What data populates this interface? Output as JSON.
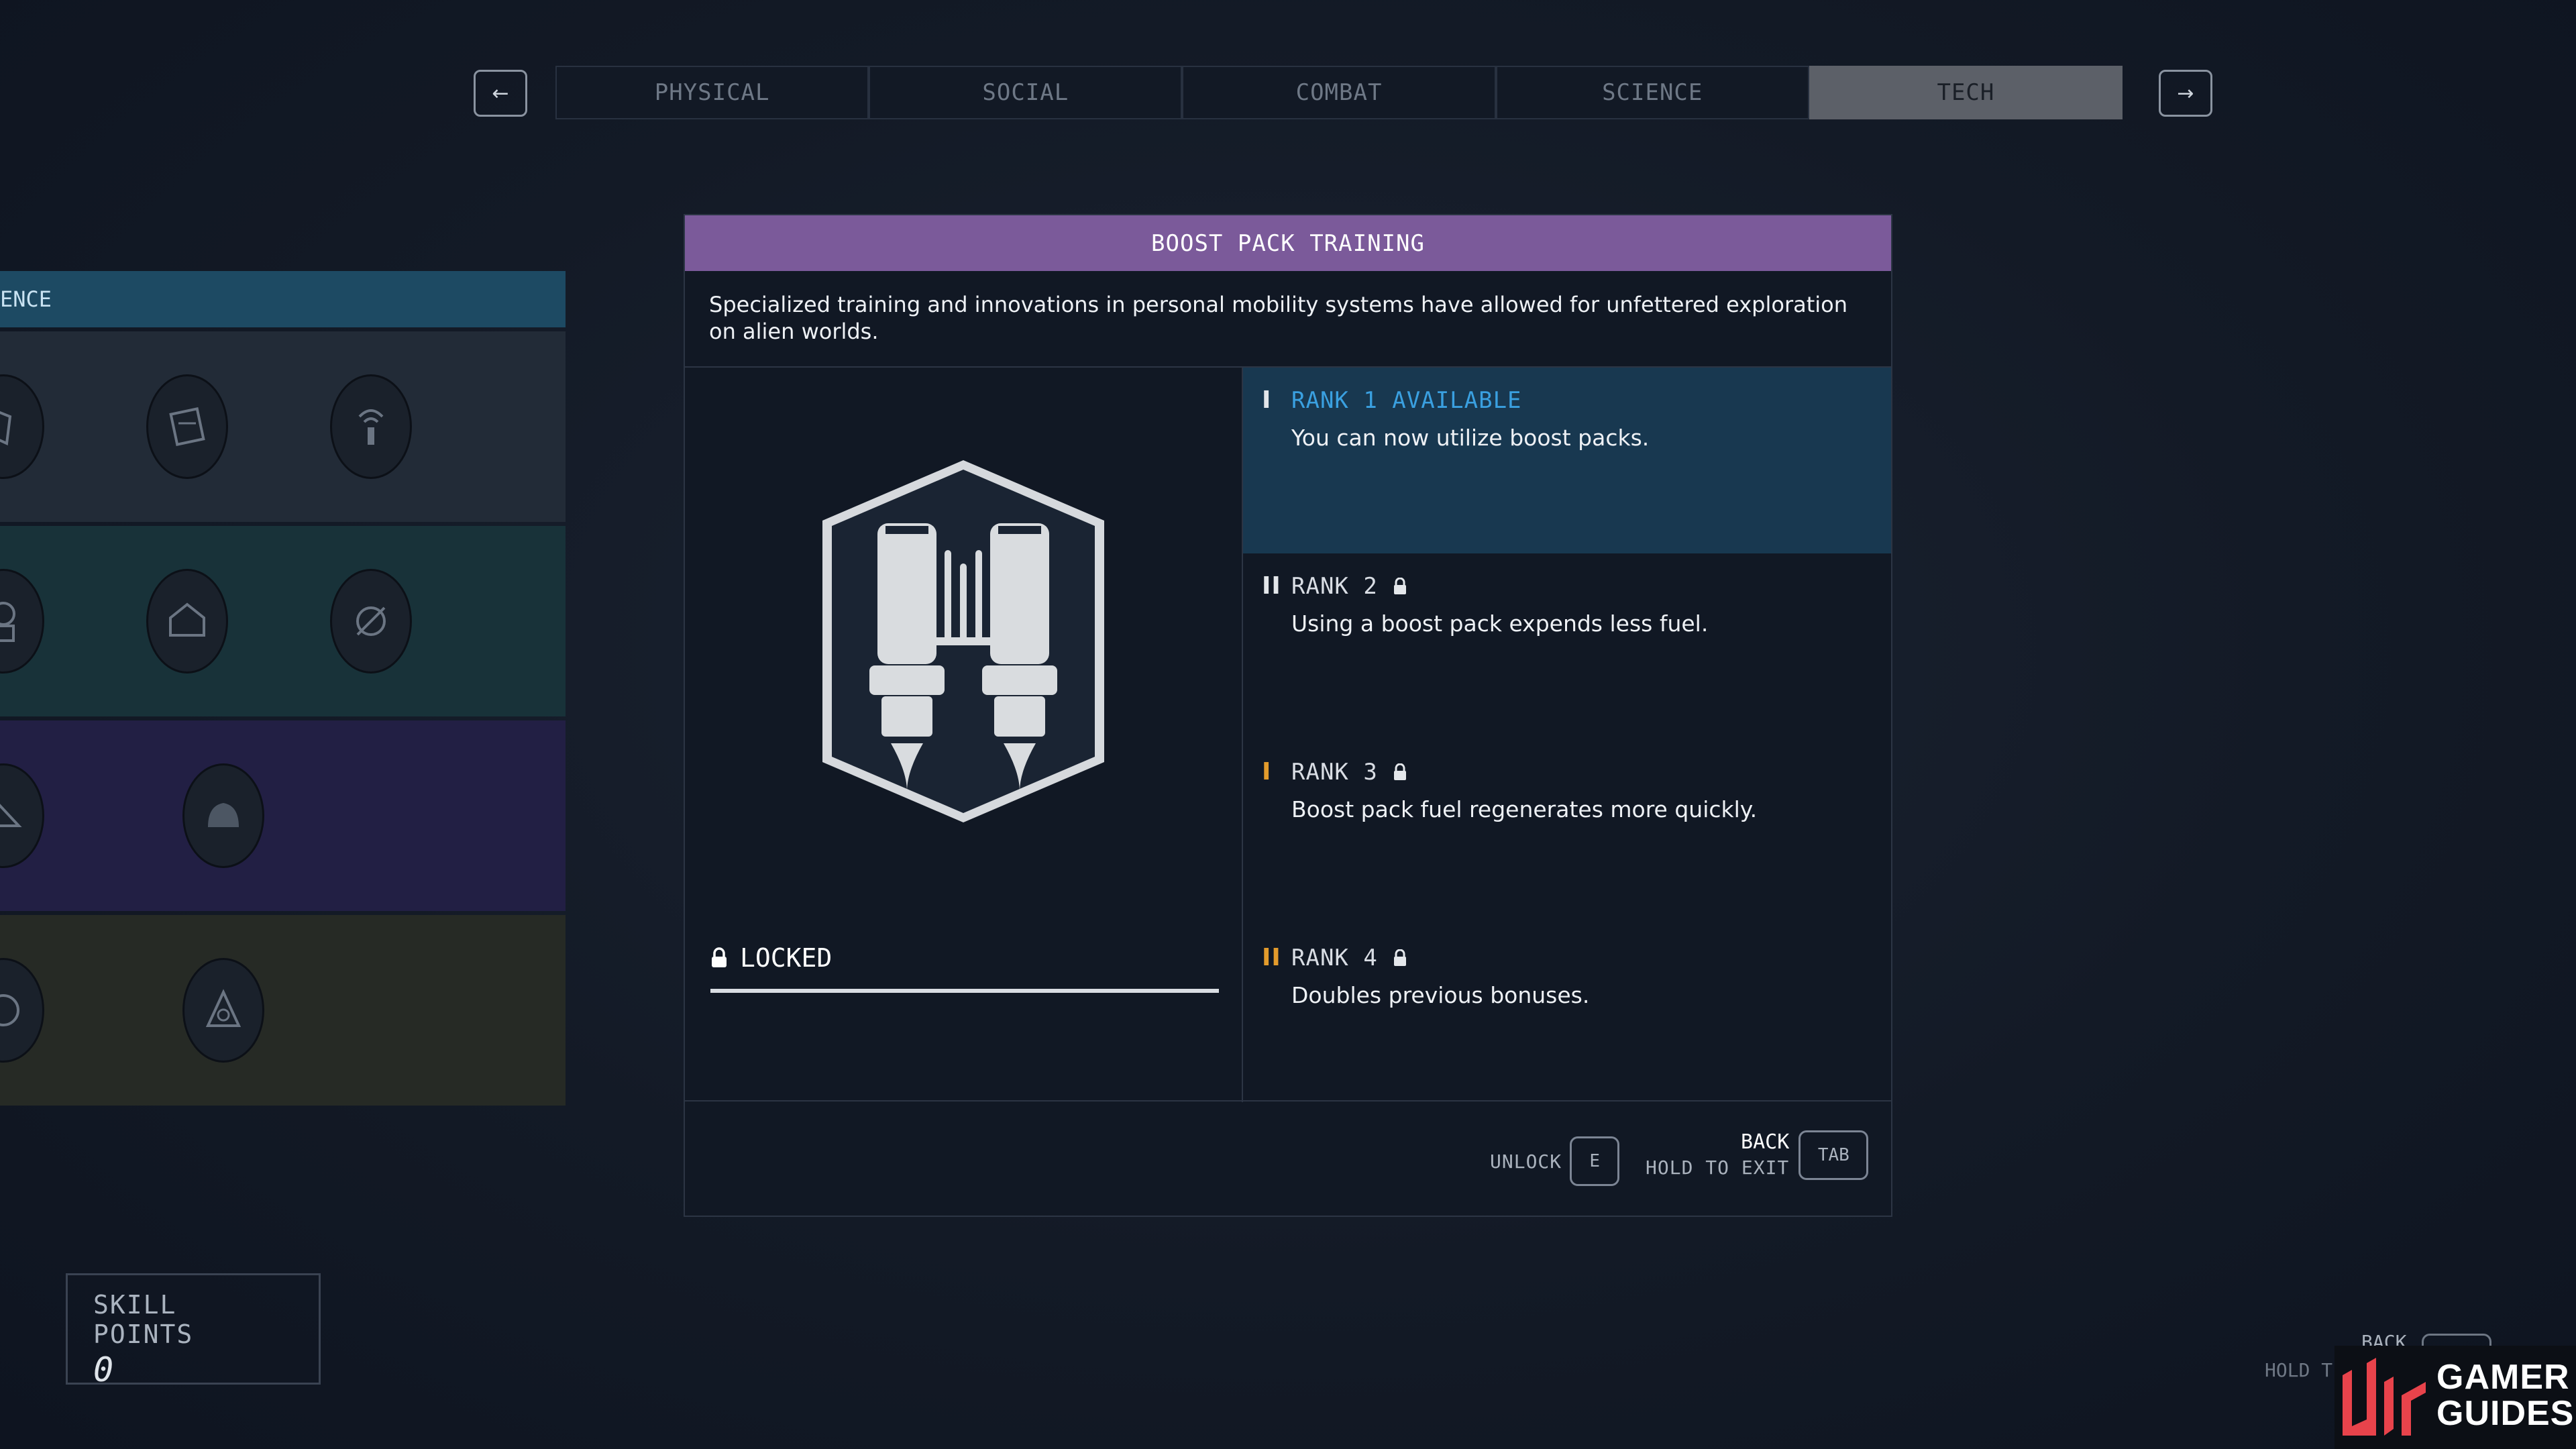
{
  "tabs": [
    {
      "label": "PHYSICAL",
      "active": false
    },
    {
      "label": "SOCIAL",
      "active": false
    },
    {
      "label": "COMBAT",
      "active": false
    },
    {
      "label": "SCIENCE",
      "active": false
    },
    {
      "label": "TECH",
      "active": true
    }
  ],
  "nav": {
    "prev_icon": "arrow-left-icon",
    "next_icon": "arrow-right-icon"
  },
  "tree": {
    "header_label": "ENCE",
    "tiers": [
      "tier-1",
      "tier-2",
      "tier-3",
      "tier-4"
    ]
  },
  "skill_points": {
    "label": "SKILL POINTS",
    "value": "0"
  },
  "panel": {
    "title": "BOOST PACK TRAINING",
    "description": "Specialized training and innovations in personal mobility systems have allowed for unfettered exploration on alien worlds.",
    "status": "LOCKED",
    "ranks": [
      {
        "title": "RANK 1 AVAILABLE",
        "desc": "You can now utilize boost packs.",
        "mark": "I",
        "locked": false
      },
      {
        "title": "RANK 2",
        "desc": "Using a boost pack expends less fuel.",
        "mark": "II",
        "locked": true
      },
      {
        "title": "RANK 3",
        "desc": "Boost pack fuel regenerates more quickly.",
        "mark": "I",
        "locked": true
      },
      {
        "title": "RANK 4",
        "desc": "Doubles previous bonuses.",
        "mark": "II",
        "locked": true
      }
    ],
    "footer": {
      "unlock_label": "UNLOCK",
      "unlock_key": "E",
      "back_label": "BACK",
      "hold_label": "HOLD TO EXIT",
      "back_key": "TAB"
    }
  },
  "background_hint": {
    "back": "BACK",
    "hold": "HOLD T",
    "key": "TAB"
  },
  "logo": {
    "line1": "GAMER",
    "line2": "GUIDES"
  },
  "colors": {
    "title_bar": "#7b5a9a",
    "rank_available": "#3aa0e0",
    "rank_mark_orange": "#e39b2c",
    "active_tab": "#5c6068"
  }
}
